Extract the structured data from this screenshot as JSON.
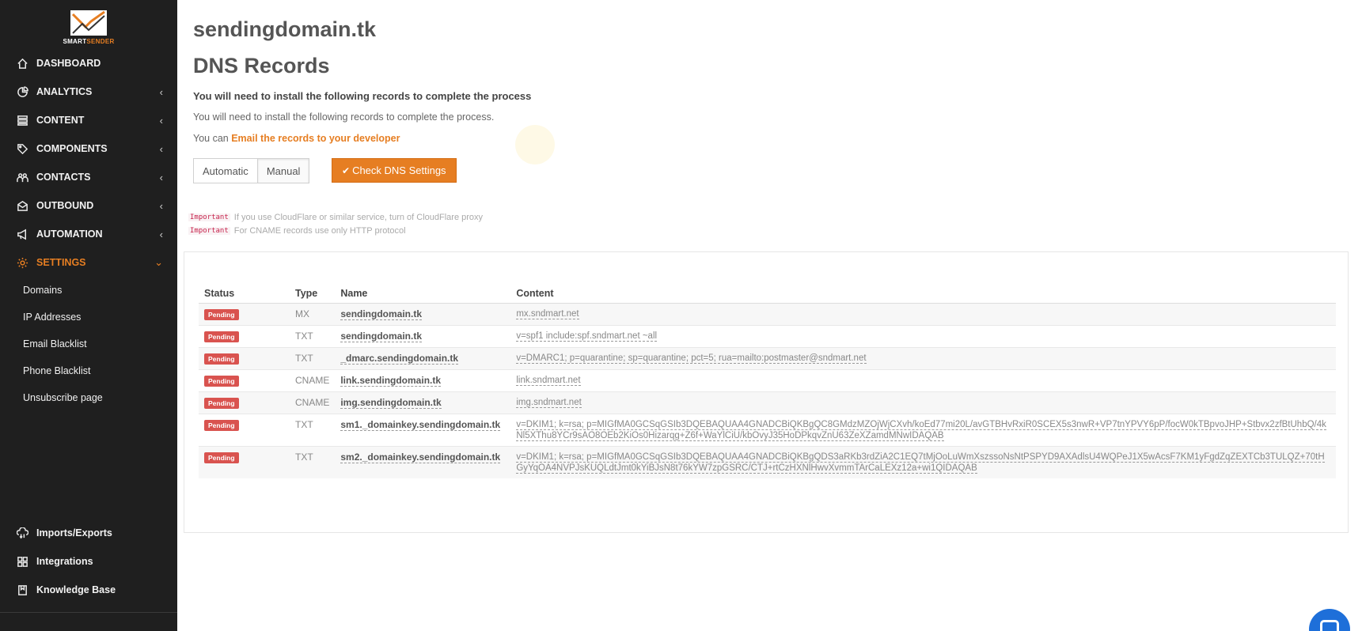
{
  "brand": {
    "name_part1": "SMART",
    "name_part2": "SENDER",
    "accent": "#e67e22"
  },
  "sidebar": {
    "items": [
      {
        "label": "DASHBOARD",
        "icon": "home-icon",
        "has_chevron": false
      },
      {
        "label": "ANALYTICS",
        "icon": "chart-pie-icon",
        "has_chevron": true
      },
      {
        "label": "CONTENT",
        "icon": "list-icon",
        "has_chevron": true
      },
      {
        "label": "COMPONENTS",
        "icon": "tag-icon",
        "has_chevron": true
      },
      {
        "label": "CONTACTS",
        "icon": "contacts-icon",
        "has_chevron": true
      },
      {
        "label": "OUTBOUND",
        "icon": "envelope-icon",
        "has_chevron": true
      },
      {
        "label": "AUTOMATION",
        "icon": "megaphone-icon",
        "has_chevron": true
      },
      {
        "label": "SETTINGS",
        "icon": "gear-icon",
        "has_chevron": true,
        "active": true
      }
    ],
    "chevron_left": "‹",
    "chevron_down": "⌄",
    "settings_sub": [
      "Domains",
      "IP Addresses",
      "Email Blacklist",
      "Phone Blacklist",
      "Unsubscribe page"
    ],
    "bottom": [
      {
        "label": "Imports/Exports",
        "icon": "cloud-transfer-icon"
      },
      {
        "label": "Integrations",
        "icon": "grid-icon"
      },
      {
        "label": "Knowledge Base",
        "icon": "book-icon"
      }
    ]
  },
  "main": {
    "domain": "sendingdomain.tk",
    "title": "DNS Records",
    "subhead": "You will need to install the following records to complete the process",
    "description": "You will need to install the following records to complete the process.",
    "email_prefix": "You can ",
    "email_link": "Email the records to your developer",
    "mode_automatic": "Automatic",
    "mode_manual": "Manual",
    "check_button": "Check DNS Settings",
    "notes": [
      {
        "tag": "Important",
        "text": "If you use CloudFlare or similar service, turn of CloudFlare proxy"
      },
      {
        "tag": "Important",
        "text": "For CNAME records use only HTTP protocol"
      }
    ]
  },
  "table": {
    "headers": [
      "Status",
      "Type",
      "Name",
      "Content"
    ],
    "rows": [
      {
        "status": "Pending",
        "type": "MX",
        "name": "sendingdomain.tk",
        "content": "mx.sndmart.net"
      },
      {
        "status": "Pending",
        "type": "TXT",
        "name": "sendingdomain.tk",
        "content": "v=spf1 include:spf.sndmart.net ~all"
      },
      {
        "status": "Pending",
        "type": "TXT",
        "name": "_dmarc.sendingdomain.tk",
        "content": "v=DMARC1; p=quarantine; sp=quarantine; pct=5; rua=mailto:postmaster@sndmart.net"
      },
      {
        "status": "Pending",
        "type": "CNAME",
        "name": "link.sendingdomain.tk",
        "content": "link.sndmart.net"
      },
      {
        "status": "Pending",
        "type": "CNAME",
        "name": "img.sendingdomain.tk",
        "content": "img.sndmart.net"
      },
      {
        "status": "Pending",
        "type": "TXT",
        "name": "sm1._domainkey.sendingdomain.tk",
        "content": "v=DKIM1; k=rsa; p=MIGfMA0GCSqGSIb3DQEBAQUAA4GNADCBiQKBgQC8GMdzMZOjWjCXvh/koEd77mi20L/avGTBHvRxiR0SCEX5s3nwR+VP7tnYPVY6pP/focW0kTBpvoJHP+Stbvx2zfBtUhbQ/4kNl5XThu8YCr9sAO8OEb2KiOs0Hizarqg+Z6f+WaYlCiU/kbOvyJ35HoDPkqvZnU63ZeXZamdMNwIDAQAB"
      },
      {
        "status": "Pending",
        "type": "TXT",
        "name": "sm2._domainkey.sendingdomain.tk",
        "content": "v=DKIM1; k=rsa; p=MIGfMA0GCSqGSIb3DQEBAQUAA4GNADCBiQKBgQDS3aRKb3rdZiA2C1EQ7tMjOoLuWmXszssoNsNtPSPYD9AXAdlsU4WQPeJ1X5wAcsF7KM1yFgdZqZEXTCb3TULQZ+70tHGyYqOA4NVPJsKUQLdtJmt0kYiBJsN8t76kYW7zpGSRC/CTJ+rtCzHXNlHwvXvmmTArCaLEXz12a+wi1QIDAQAB"
      }
    ]
  },
  "colors": {
    "sidebar_bg": "#1f1f1f",
    "accent": "#e67e22",
    "pending": "#d9534f",
    "chat": "#1e6fd9"
  }
}
